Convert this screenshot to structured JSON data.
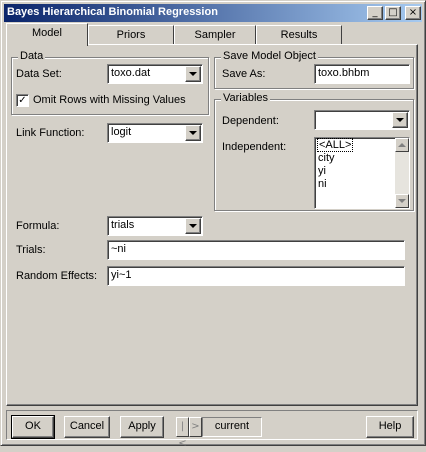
{
  "window": {
    "title": "Bayes Hierarchical Binomial Regression",
    "controls": {
      "minimize": "_",
      "maximize": "□",
      "close": "×"
    }
  },
  "tabs": [
    {
      "label": "Model",
      "active": true
    },
    {
      "label": "Priors",
      "active": false
    },
    {
      "label": "Sampler",
      "active": false
    },
    {
      "label": "Results",
      "active": false
    }
  ],
  "data_group": {
    "legend": "Data",
    "data_set_label": "Data Set:",
    "data_set_value": "toxo.dat",
    "omit_rows_label": "Omit Rows with Missing Values",
    "omit_rows_checked": "✓"
  },
  "save_group": {
    "legend": "Save Model Object",
    "save_as_label": "Save As:",
    "save_as_value": "toxo.bhbm"
  },
  "link": {
    "label": "Link Function:",
    "value": "logit"
  },
  "variables": {
    "legend": "Variables",
    "dependent_label": "Dependent:",
    "dependent_value": "",
    "independent_label": "Independent:",
    "independent_items": [
      "<ALL>",
      "city",
      "yi",
      "ni"
    ]
  },
  "formula": {
    "label": "Formula:",
    "value": "trials"
  },
  "trials": {
    "label": "Trials:",
    "value": "~ni"
  },
  "random_effects": {
    "label": "Random Effects:",
    "value": "yi~1"
  },
  "buttons": {
    "ok": "OK",
    "cancel": "Cancel",
    "apply": "Apply",
    "prev": "|<",
    "next": ">",
    "current": "current",
    "help": "Help"
  }
}
